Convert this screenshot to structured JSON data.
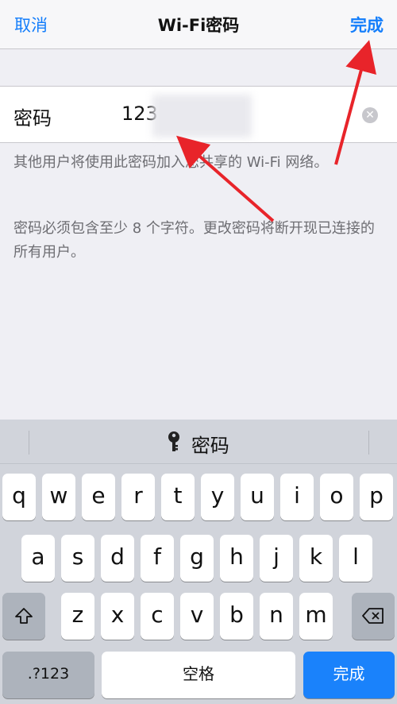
{
  "nav": {
    "cancel": "取消",
    "title": "Wi-Fi密码",
    "done": "完成"
  },
  "password": {
    "label": "密码",
    "value": "123"
  },
  "footnotes": [
    "其他用户将使用此密码加入您共享的 Wi-Fi 网络。",
    "密码必须包含至少 8 个字符。更改密码将断开现已连接的所有用户。"
  ],
  "keyboard": {
    "suggestion": "密码",
    "row1": [
      "q",
      "w",
      "e",
      "r",
      "t",
      "y",
      "u",
      "i",
      "o",
      "p"
    ],
    "row2": [
      "a",
      "s",
      "d",
      "f",
      "g",
      "h",
      "j",
      "k",
      "l"
    ],
    "row3": [
      "z",
      "x",
      "c",
      "v",
      "b",
      "n",
      "m"
    ],
    "numbers": ".?123",
    "space": "空格",
    "done": "完成"
  },
  "icons": {
    "clear": "clear-icon",
    "key": "key-icon",
    "shift": "shift-icon",
    "delete": "delete-icon"
  },
  "colors": {
    "accent": "#147efb",
    "annotation": "#e8242a"
  }
}
